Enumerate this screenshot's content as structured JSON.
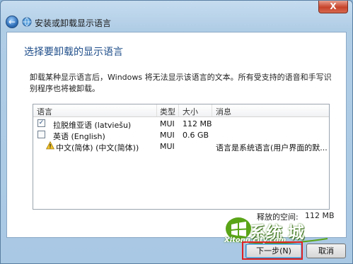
{
  "window": {
    "title": "安装或卸载显示语言",
    "close_label": "X",
    "back_label": "←"
  },
  "page": {
    "heading": "选择要卸载的显示语言",
    "description": "卸载某种显示语言后，Windows 将无法显示该语言的文本。所有受支持的语音和手写识别程序也将被卸载。"
  },
  "list": {
    "headers": {
      "language": "语言",
      "type": "类型",
      "size": "大小",
      "message": "消息"
    },
    "rows": [
      {
        "checked": true,
        "name": "拉脱维亚语 (latviešu)",
        "type": "MUI",
        "size": "112 MB",
        "message": "",
        "warning": false
      },
      {
        "checked": false,
        "name": "英语 (English)",
        "type": "MUI",
        "size": "0.6 GB",
        "message": "",
        "warning": false
      },
      {
        "checked": null,
        "name": "中文(简体) (中文(简体))",
        "type": "MUI",
        "size": "",
        "message": "语言是系统语言(用户界面的默...",
        "warning": true
      }
    ]
  },
  "free_space": {
    "label": "释放的空间:",
    "value": "112 MB"
  },
  "buttons": {
    "next": "下一步(N)",
    "cancel": "取消"
  },
  "watermark": {
    "brand": "系统 城",
    "url": "Xitong city.com"
  },
  "colors": {
    "heading": "#1f4e8a",
    "highlight": "#e02020"
  }
}
